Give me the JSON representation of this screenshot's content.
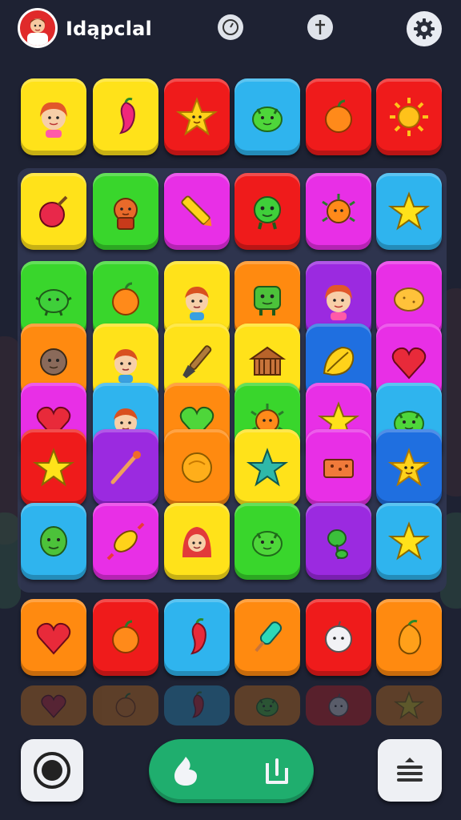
{
  "header": {
    "title": "Idąpclal",
    "avatar_icon": "player-avatar-icon",
    "icons": [
      "timer-icon",
      "dagger-icon",
      "settings-gear-icon"
    ]
  },
  "colors": {
    "yellow": "#ffe21a",
    "red": "#ef1b1b",
    "cyan": "#2fb4ee",
    "green": "#39d62c",
    "magenta": "#e82fe6",
    "orange": "#ff8a10",
    "purple": "#9b2ae0",
    "blue": "#1f6fe0",
    "background": "#1e2233",
    "pill": "#1fae6e"
  },
  "board": {
    "rows": [
      [
        {
          "color": "yellow",
          "icon": "girl-face-icon"
        },
        {
          "color": "yellow",
          "icon": "pink-chili-icon"
        },
        {
          "color": "red",
          "icon": "star-face-icon"
        },
        {
          "color": "cyan",
          "icon": "green-blob-icon"
        },
        {
          "color": "red",
          "icon": "orange-fruit-icon"
        },
        {
          "color": "red",
          "icon": "sun-icon"
        }
      ],
      [
        {
          "color": "yellow",
          "icon": "red-radish-icon"
        },
        {
          "color": "green",
          "icon": "orange-creature-icon"
        },
        {
          "color": "magenta",
          "icon": "crayon-icon"
        },
        {
          "color": "red",
          "icon": "green-monster-icon"
        },
        {
          "color": "magenta",
          "icon": "orange-bug-icon"
        },
        {
          "color": "cyan",
          "icon": "yellow-star-icon"
        }
      ],
      [
        {
          "color": "green",
          "icon": "green-turtle-icon"
        },
        {
          "color": "green",
          "icon": "orange-fruit-icon"
        },
        {
          "color": "yellow",
          "icon": "boy-face-icon"
        },
        {
          "color": "orange",
          "icon": "green-robot-icon"
        },
        {
          "color": "purple",
          "icon": "girl-face-icon"
        },
        {
          "color": "magenta",
          "icon": "potato-icon"
        }
      ],
      [
        {
          "color": "orange",
          "icon": "brown-creature-icon"
        },
        {
          "color": "yellow",
          "icon": "boy-face-icon"
        },
        {
          "color": "yellow",
          "icon": "brush-icon"
        },
        {
          "color": "yellow",
          "icon": "house-icon"
        },
        {
          "color": "blue",
          "icon": "leaf-icon"
        },
        {
          "color": "magenta",
          "icon": "heart-icon"
        }
      ],
      [
        {
          "color": "magenta",
          "icon": "heart-icon"
        },
        {
          "color": "cyan",
          "icon": "boy-face-icon"
        },
        {
          "color": "orange",
          "icon": "green-heart-icon"
        },
        {
          "color": "green",
          "icon": "orange-bug-icon"
        },
        {
          "color": "magenta",
          "icon": "yellow-star-icon"
        },
        {
          "color": "cyan",
          "icon": "green-blob-icon"
        }
      ],
      [
        {
          "color": "red",
          "icon": "yellow-star-icon"
        },
        {
          "color": "purple",
          "icon": "wand-icon"
        },
        {
          "color": "orange",
          "icon": "orange-ball-icon"
        },
        {
          "color": "yellow",
          "icon": "teal-star-icon"
        },
        {
          "color": "magenta",
          "icon": "brick-icon"
        },
        {
          "color": "blue",
          "icon": "star-face-icon"
        }
      ],
      [
        {
          "color": "cyan",
          "icon": "green-face-icon"
        },
        {
          "color": "magenta",
          "icon": "candy-icon"
        },
        {
          "color": "yellow",
          "icon": "hood-girl-icon"
        },
        {
          "color": "green",
          "icon": "green-blob-icon"
        },
        {
          "color": "purple",
          "icon": "green-chili-icon"
        },
        {
          "color": "cyan",
          "icon": "yellow-star-icon"
        }
      ],
      [
        {
          "color": "orange",
          "icon": "heart-icon"
        },
        {
          "color": "red",
          "icon": "orange-fruit-icon"
        },
        {
          "color": "cyan",
          "icon": "red-chili-icon"
        },
        {
          "color": "orange",
          "icon": "popsicle-icon"
        },
        {
          "color": "red",
          "icon": "white-ghost-icon"
        },
        {
          "color": "orange",
          "icon": "mango-icon"
        }
      ],
      [
        {
          "color": "orange",
          "icon": "heart-icon"
        },
        {
          "color": "orange",
          "icon": "orange-fruit-icon"
        },
        {
          "color": "cyan",
          "icon": "red-chili-icon"
        },
        {
          "color": "orange",
          "icon": "green-blob-icon"
        },
        {
          "color": "red",
          "icon": "white-ghost-icon"
        },
        {
          "color": "orange",
          "icon": "yellow-star-icon"
        }
      ]
    ]
  },
  "footer": {
    "left_icon": "record-icon",
    "pill_icons": [
      "drop-icon",
      "exit-icon"
    ],
    "right_icon": "menu-lines-icon"
  }
}
